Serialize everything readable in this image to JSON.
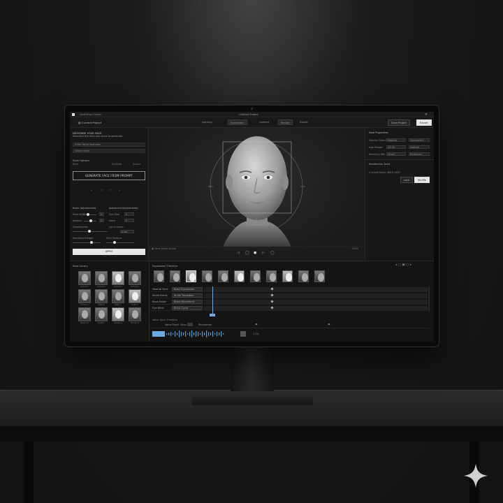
{
  "titlebar": {
    "app_name": "FaceForge Studio",
    "window_title": "Untitled Project",
    "close_glyph": "×"
  },
  "toolbar": {
    "project": "▤ Current Project",
    "items": [
      "Lighting",
      "Expression",
      "Camera",
      "Render",
      "Export"
    ],
    "save_label": "Save Project",
    "export_label": "Export"
  },
  "prompt_panel": {
    "title": "DESCRIBE YOUR FACE",
    "description": "Describe the face you want to generate",
    "field1": "Enter facial features",
    "field2": "Select style",
    "options_label": "Style Options",
    "options": [
      "Real",
      "Stylized",
      "Anime"
    ],
    "generate_label": "GENERATE FACE FROM PROMPT",
    "nav_icons": [
      "‹",
      "◦",
      "◦",
      "›"
    ]
  },
  "adjust_panel": {
    "title": "Basic Adjustments",
    "title_right": "Advanced Adjustments",
    "rows": [
      {
        "label": "Face Width",
        "value": "0",
        "right_label": "Eye Size",
        "right_value": "0"
      },
      {
        "label": "Jawline",
        "value": "0",
        "right_label": "Nose",
        "right_value": "0"
      },
      {
        "label": "Cheekbones",
        "value": "0",
        "right_label": "Lip Fullness",
        "right_value": "Auto"
      }
    ],
    "extra_left": "Forehead Height",
    "extra_right": "Skin Texture",
    "apply_label": "APPLY"
  },
  "viewport": {
    "status_left": "◉ Face Mesh Active",
    "status_right": "100%",
    "controls": [
      "◁",
      "◯",
      "●",
      "▷",
      "◯"
    ]
  },
  "properties": {
    "title": "Face Properties",
    "rows": [
      {
        "label": "Gender Blend",
        "value": "Neutral",
        "value2": "Symmetric"
      },
      {
        "label": "Age Range",
        "value": "25-30",
        "value2": "Natural"
      },
      {
        "label": "Ethnicity Mix",
        "value": "Mixed",
        "value2": "Balanced"
      }
    ],
    "section2": "Randomize Seed",
    "seed_label": "Current Seed: 4819 2637",
    "btn1": "Lock",
    "btn2": "Shuffle"
  },
  "library": {
    "title": "Face Library",
    "labels": [
      "Portrait 1",
      "Portrait 2",
      "Portrait 3",
      "Portrait 4",
      "Female A",
      "Male B",
      "Elder C",
      "Youth D",
      "Neutral E",
      "Model F",
      "Sketch G",
      "Render H"
    ]
  },
  "timeline": {
    "title": "Expression Timeline",
    "tracks": [
      {
        "name": "Neutral Face",
        "clip": "Base Expression"
      },
      {
        "name": "Smile Blend",
        "clip": "Smile Transition"
      },
      {
        "name": "Brow Raise",
        "clip": "Brow Movement"
      },
      {
        "name": "Eye Blink",
        "clip": "Blink Cycle"
      }
    ],
    "audio_section": "Voice Sync Timeline",
    "audio_tabs": [
      "Voice Track",
      "Sync",
      "Phonemes"
    ],
    "audio_time": "1:24"
  },
  "colors": {
    "accent_blue": "#6ea8e0",
    "panel": "#171717",
    "screen_bg": "#151515"
  }
}
